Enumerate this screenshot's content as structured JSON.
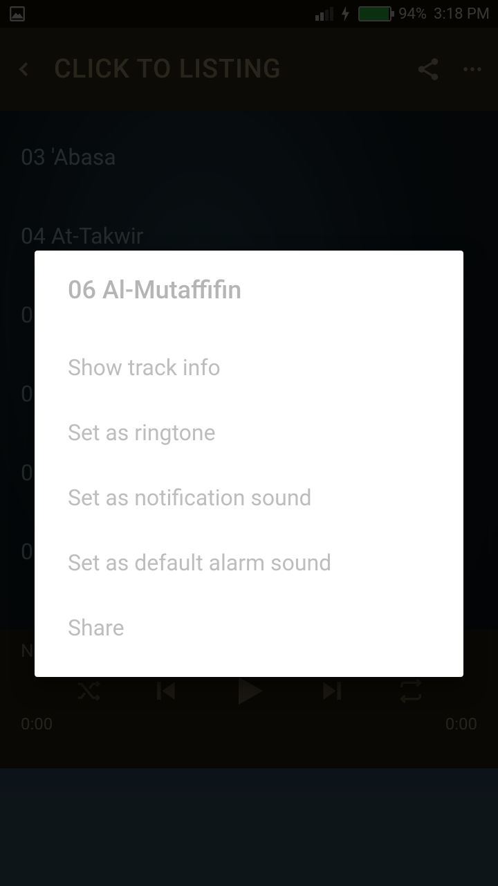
{
  "status": {
    "battery_pct": "94%",
    "time": "3:18 PM"
  },
  "appbar": {
    "title": "CLICK TO LISTING"
  },
  "tracks": [
    "03 'Abasa",
    "04 At-Takwir",
    "0",
    "0",
    "0",
    "0"
  ],
  "player": {
    "now_playing": "No Track",
    "elapsed": "0:00",
    "total": "0:00"
  },
  "dialog": {
    "title": "06 Al-Mutaffifin",
    "items": [
      "Show track info",
      "Set as ringtone",
      "Set as notification sound",
      "Set as default alarm sound",
      "Share"
    ]
  }
}
